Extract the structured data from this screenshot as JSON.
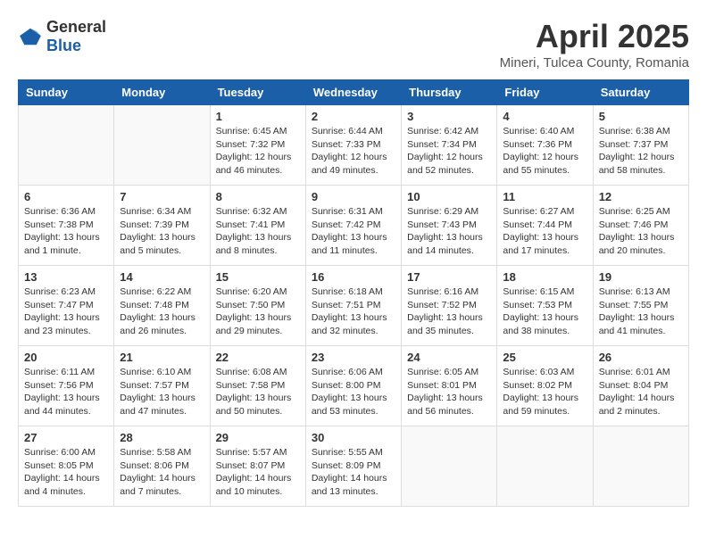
{
  "header": {
    "logo_general": "General",
    "logo_blue": "Blue",
    "month_title": "April 2025",
    "subtitle": "Mineri, Tulcea County, Romania"
  },
  "weekdays": [
    "Sunday",
    "Monday",
    "Tuesday",
    "Wednesday",
    "Thursday",
    "Friday",
    "Saturday"
  ],
  "weeks": [
    [
      {
        "day": "",
        "lines": []
      },
      {
        "day": "",
        "lines": []
      },
      {
        "day": "1",
        "lines": [
          "Sunrise: 6:45 AM",
          "Sunset: 7:32 PM",
          "Daylight: 12 hours",
          "and 46 minutes."
        ]
      },
      {
        "day": "2",
        "lines": [
          "Sunrise: 6:44 AM",
          "Sunset: 7:33 PM",
          "Daylight: 12 hours",
          "and 49 minutes."
        ]
      },
      {
        "day": "3",
        "lines": [
          "Sunrise: 6:42 AM",
          "Sunset: 7:34 PM",
          "Daylight: 12 hours",
          "and 52 minutes."
        ]
      },
      {
        "day": "4",
        "lines": [
          "Sunrise: 6:40 AM",
          "Sunset: 7:36 PM",
          "Daylight: 12 hours",
          "and 55 minutes."
        ]
      },
      {
        "day": "5",
        "lines": [
          "Sunrise: 6:38 AM",
          "Sunset: 7:37 PM",
          "Daylight: 12 hours",
          "and 58 minutes."
        ]
      }
    ],
    [
      {
        "day": "6",
        "lines": [
          "Sunrise: 6:36 AM",
          "Sunset: 7:38 PM",
          "Daylight: 13 hours",
          "and 1 minute."
        ]
      },
      {
        "day": "7",
        "lines": [
          "Sunrise: 6:34 AM",
          "Sunset: 7:39 PM",
          "Daylight: 13 hours",
          "and 5 minutes."
        ]
      },
      {
        "day": "8",
        "lines": [
          "Sunrise: 6:32 AM",
          "Sunset: 7:41 PM",
          "Daylight: 13 hours",
          "and 8 minutes."
        ]
      },
      {
        "day": "9",
        "lines": [
          "Sunrise: 6:31 AM",
          "Sunset: 7:42 PM",
          "Daylight: 13 hours",
          "and 11 minutes."
        ]
      },
      {
        "day": "10",
        "lines": [
          "Sunrise: 6:29 AM",
          "Sunset: 7:43 PM",
          "Daylight: 13 hours",
          "and 14 minutes."
        ]
      },
      {
        "day": "11",
        "lines": [
          "Sunrise: 6:27 AM",
          "Sunset: 7:44 PM",
          "Daylight: 13 hours",
          "and 17 minutes."
        ]
      },
      {
        "day": "12",
        "lines": [
          "Sunrise: 6:25 AM",
          "Sunset: 7:46 PM",
          "Daylight: 13 hours",
          "and 20 minutes."
        ]
      }
    ],
    [
      {
        "day": "13",
        "lines": [
          "Sunrise: 6:23 AM",
          "Sunset: 7:47 PM",
          "Daylight: 13 hours",
          "and 23 minutes."
        ]
      },
      {
        "day": "14",
        "lines": [
          "Sunrise: 6:22 AM",
          "Sunset: 7:48 PM",
          "Daylight: 13 hours",
          "and 26 minutes."
        ]
      },
      {
        "day": "15",
        "lines": [
          "Sunrise: 6:20 AM",
          "Sunset: 7:50 PM",
          "Daylight: 13 hours",
          "and 29 minutes."
        ]
      },
      {
        "day": "16",
        "lines": [
          "Sunrise: 6:18 AM",
          "Sunset: 7:51 PM",
          "Daylight: 13 hours",
          "and 32 minutes."
        ]
      },
      {
        "day": "17",
        "lines": [
          "Sunrise: 6:16 AM",
          "Sunset: 7:52 PM",
          "Daylight: 13 hours",
          "and 35 minutes."
        ]
      },
      {
        "day": "18",
        "lines": [
          "Sunrise: 6:15 AM",
          "Sunset: 7:53 PM",
          "Daylight: 13 hours",
          "and 38 minutes."
        ]
      },
      {
        "day": "19",
        "lines": [
          "Sunrise: 6:13 AM",
          "Sunset: 7:55 PM",
          "Daylight: 13 hours",
          "and 41 minutes."
        ]
      }
    ],
    [
      {
        "day": "20",
        "lines": [
          "Sunrise: 6:11 AM",
          "Sunset: 7:56 PM",
          "Daylight: 13 hours",
          "and 44 minutes."
        ]
      },
      {
        "day": "21",
        "lines": [
          "Sunrise: 6:10 AM",
          "Sunset: 7:57 PM",
          "Daylight: 13 hours",
          "and 47 minutes."
        ]
      },
      {
        "day": "22",
        "lines": [
          "Sunrise: 6:08 AM",
          "Sunset: 7:58 PM",
          "Daylight: 13 hours",
          "and 50 minutes."
        ]
      },
      {
        "day": "23",
        "lines": [
          "Sunrise: 6:06 AM",
          "Sunset: 8:00 PM",
          "Daylight: 13 hours",
          "and 53 minutes."
        ]
      },
      {
        "day": "24",
        "lines": [
          "Sunrise: 6:05 AM",
          "Sunset: 8:01 PM",
          "Daylight: 13 hours",
          "and 56 minutes."
        ]
      },
      {
        "day": "25",
        "lines": [
          "Sunrise: 6:03 AM",
          "Sunset: 8:02 PM",
          "Daylight: 13 hours",
          "and 59 minutes."
        ]
      },
      {
        "day": "26",
        "lines": [
          "Sunrise: 6:01 AM",
          "Sunset: 8:04 PM",
          "Daylight: 14 hours",
          "and 2 minutes."
        ]
      }
    ],
    [
      {
        "day": "27",
        "lines": [
          "Sunrise: 6:00 AM",
          "Sunset: 8:05 PM",
          "Daylight: 14 hours",
          "and 4 minutes."
        ]
      },
      {
        "day": "28",
        "lines": [
          "Sunrise: 5:58 AM",
          "Sunset: 8:06 PM",
          "Daylight: 14 hours",
          "and 7 minutes."
        ]
      },
      {
        "day": "29",
        "lines": [
          "Sunrise: 5:57 AM",
          "Sunset: 8:07 PM",
          "Daylight: 14 hours",
          "and 10 minutes."
        ]
      },
      {
        "day": "30",
        "lines": [
          "Sunrise: 5:55 AM",
          "Sunset: 8:09 PM",
          "Daylight: 14 hours",
          "and 13 minutes."
        ]
      },
      {
        "day": "",
        "lines": []
      },
      {
        "day": "",
        "lines": []
      },
      {
        "day": "",
        "lines": []
      }
    ]
  ]
}
